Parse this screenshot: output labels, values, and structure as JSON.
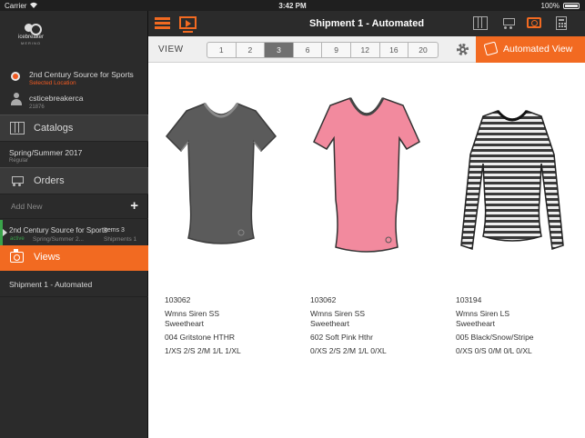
{
  "status_bar": {
    "carrier": "Carrier",
    "time": "3:42 PM",
    "battery": "100%"
  },
  "sidebar": {
    "logo": {
      "brand": "icebreaker",
      "sub": "MERINO"
    },
    "location": {
      "name": "2nd Century Source for Sports",
      "sub": "Selected Location"
    },
    "user": {
      "name": "csticebreakerca",
      "id": "21876"
    },
    "catalogs_label": "Catalogs",
    "season": {
      "name": "Spring/Summer 2017",
      "type": "Regular"
    },
    "orders_label": "Orders",
    "add_new_label": "Add New",
    "add_new_plus": "+",
    "order": {
      "name": "2nd Century Source for Sports",
      "items": "Items 3",
      "status": "active",
      "season": "Spring/Summer 2...",
      "shipments": "Shipments 1"
    },
    "views_label": "Views",
    "shipment_item": "Shipment 1 - Automated"
  },
  "navbar": {
    "title": "Shipment 1 - Automated",
    "accent": "#f26a21"
  },
  "viewbar": {
    "label": "VIEW",
    "options": [
      "1",
      "2",
      "3",
      "6",
      "9",
      "12",
      "16",
      "20"
    ],
    "selected": "3",
    "automated_label": "Automated View"
  },
  "products": [
    {
      "style": "103062",
      "name1": "Wmns Siren SS",
      "name2": "Sweetheart",
      "color": "004 Gritstone HTHR",
      "sizes": "1/XS 2/S 2/M 1/L 1/XL"
    },
    {
      "style": "103062",
      "name1": "Wmns Siren SS",
      "name2": "Sweetheart",
      "color": "602 Soft Pink Hthr",
      "sizes": "0/XS 2/S 2/M 1/L 0/XL"
    },
    {
      "style": "103194",
      "name1": "Wmns Siren LS",
      "name2": "Sweetheart",
      "color": "005 Black/Snow/Stripe",
      "sizes": "0/XS 0/S 0/M 0/L 0/XL"
    }
  ]
}
